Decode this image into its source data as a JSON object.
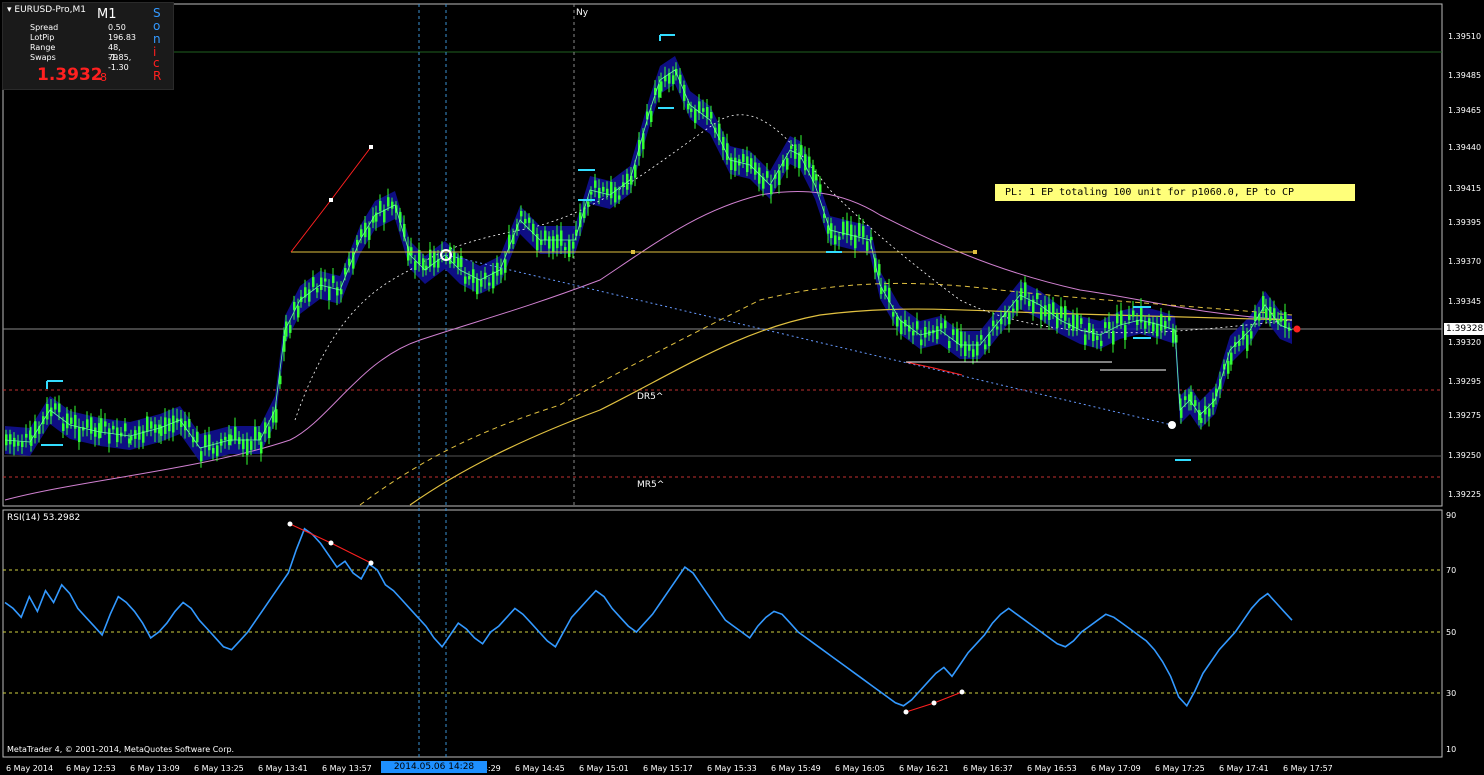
{
  "info_panel": {
    "symbol_dropdown": "EURUSD-Pro,M1",
    "symbol_overlay": "EURUSD",
    "timeframe": "M1",
    "rows": [
      {
        "label": "Spread",
        "value": "0.50"
      },
      {
        "label": "LotPip",
        "value": "196.83"
      },
      {
        "label": "Range",
        "value": "48, 79"
      },
      {
        "label": "Swaps",
        "value": "-1.85, -1.30"
      }
    ],
    "price_big": "1.3932",
    "price_small": "8",
    "sonic_letters": [
      "S",
      "o",
      "n",
      "i",
      "c",
      "R"
    ]
  },
  "main_chart": {
    "price_axis_labels": [
      "1.39510",
      "1.39485",
      "1.39465",
      "1.39440",
      "1.39415",
      "1.39395",
      "1.39370",
      "1.39345",
      "1.39320",
      "1.39295",
      "1.39275",
      "1.39250",
      "1.39225"
    ],
    "current_price": "1.39328",
    "marker_ny": "Ny",
    "marker_dr5": "DR5^",
    "marker_mr5": "MR5^",
    "pl_text": "PL: 1 EP totaling 100 unit for p1060.0, EP to CP"
  },
  "rsi_panel": {
    "title": "RSI(14) 53.2982",
    "levels": [
      "90",
      "70",
      "50",
      "30",
      "10"
    ]
  },
  "time_axis": {
    "labels": [
      "6 May 2014",
      "6 May 12:53",
      "6 May 13:09",
      "6 May 13:25",
      "6 May 13:41",
      "6 May 13:57",
      "6 May 14:29",
      "6 May 14:45",
      "6 May 15:01",
      "6 May 15:17",
      "6 May 15:33",
      "6 May 15:49",
      "6 May 16:05",
      "6 May 16:21",
      "6 May 16:37",
      "6 May 16:53",
      "6 May 17:09",
      "6 May 17:25",
      "6 May 17:41",
      "6 May 17:57"
    ],
    "highlight": "2014.05.06 14:28"
  },
  "copyright": "MetaTrader 4, © 2001-2014, MetaQuotes Software Corp.",
  "colors": {
    "candles": "#33ff33",
    "rsi": "#3399ff",
    "band": "#1010a0",
    "ma_pink": "#d080d0",
    "ma_yellow": "#e0c040",
    "pl_box": "#ffff7a"
  },
  "chart_data": {
    "type": "line",
    "title": "EURUSD-Pro,M1",
    "rsi_series": {
      "name": "RSI(14)",
      "values": [
        60,
        58,
        55,
        62,
        57,
        64,
        60,
        66,
        63,
        58,
        55,
        52,
        49,
        56,
        62,
        60,
        57,
        53,
        48,
        50,
        53,
        57,
        60,
        58,
        54,
        51,
        48,
        45,
        44,
        47,
        50,
        54,
        58,
        62,
        66,
        70,
        78,
        85,
        83,
        80,
        76,
        72,
        74,
        70,
        68,
        73,
        71,
        66,
        64,
        61,
        58,
        55,
        52,
        48,
        45,
        49,
        53,
        51,
        48,
        46,
        50,
        52,
        55,
        58,
        56,
        53,
        50,
        47,
        45,
        50,
        55,
        58,
        61,
        64,
        62,
        58,
        55,
        52,
        50,
        53,
        56,
        60,
        64,
        68,
        72,
        70,
        66,
        62,
        58,
        54,
        52,
        50,
        48,
        52,
        55,
        57,
        56,
        53,
        50,
        48,
        46,
        44,
        42,
        40,
        38,
        36,
        34,
        32,
        30,
        28,
        26,
        25,
        27,
        30,
        33,
        36,
        38,
        35,
        39,
        43,
        46,
        49,
        53,
        56,
        58,
        56,
        54,
        52,
        50,
        48,
        46,
        45,
        47,
        50,
        52,
        54,
        56,
        55,
        53,
        51,
        49,
        47,
        44,
        40,
        35,
        28,
        25,
        30,
        36,
        40,
        44,
        47,
        50,
        54,
        58,
        61,
        63,
        60,
        57,
        54
      ]
    },
    "rsi_ylim": [
      10,
      90
    ]
  }
}
